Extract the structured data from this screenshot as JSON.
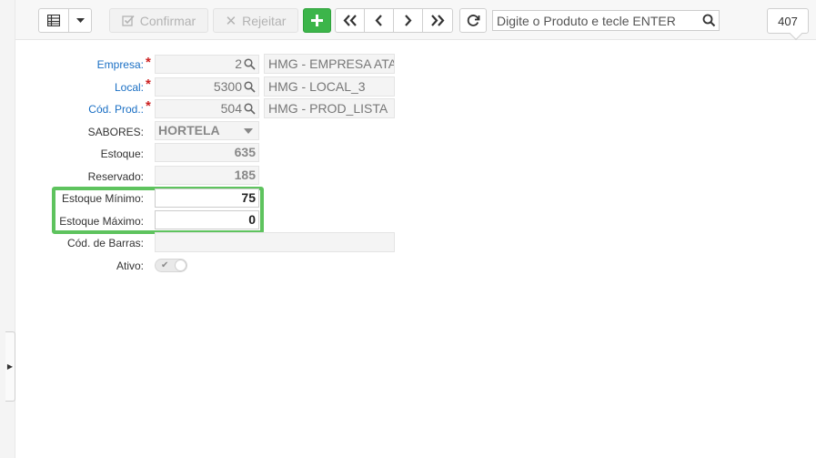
{
  "toolbar": {
    "confirm_label": "Confirmar",
    "reject_label": "Rejeitar",
    "search_placeholder": "Digite o Produto e tecle ENTER",
    "record_count": "407"
  },
  "form": {
    "empresa": {
      "label": "Empresa:",
      "code": "2",
      "description": "HMG - EMPRESA ATACADO"
    },
    "local": {
      "label": "Local:",
      "code": "5300",
      "description": "HMG - LOCAL_3"
    },
    "produto": {
      "label": "Cód. Prod.:",
      "code": "504",
      "description": "HMG - PROD_LISTA"
    },
    "sabores": {
      "label": "SABORES:",
      "value": "HORTELA"
    },
    "estoque": {
      "label": "Estoque:",
      "value": "635"
    },
    "reservado": {
      "label": "Reservado:",
      "value": "185"
    },
    "estoque_minimo": {
      "label": "Estoque Mínimo:",
      "value": "75"
    },
    "estoque_maximo": {
      "label": "Estoque Máximo:",
      "value": "0"
    },
    "cod_barras": {
      "label": "Cód. de Barras:",
      "value": ""
    },
    "ativo": {
      "label": "Ativo:"
    }
  },
  "colors": {
    "required_label": "#1a6fc4",
    "add_button": "#3cb54a",
    "highlight": "#5ec35e"
  }
}
